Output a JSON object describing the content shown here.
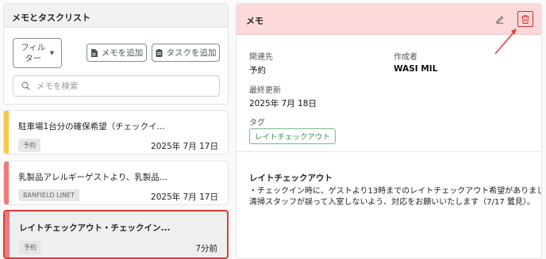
{
  "left_panel": {
    "title": "メモとタスクリスト",
    "filter_label": "フィルター",
    "add_memo_label": "メモを追加",
    "add_task_label": "タスクを追加",
    "search_placeholder": "メモを検索"
  },
  "memo_list": [
    {
      "title": "駐車場1台分の確保希望（チェックイ...",
      "tag": "予約",
      "date": "2025年 7月 17日",
      "color": "#f7c84a"
    },
    {
      "title": "乳製品アレルギーゲストより、乳製品...",
      "tag": "BANFIELD LINET",
      "date": "2025年 7月 17日",
      "color": "#ef7a7a"
    },
    {
      "title": "レイトチェックアウト・チェックイン...",
      "tag": "予約",
      "date": "7分前",
      "color": "#ef7a7a"
    }
  ],
  "detail": {
    "header_title": "メモ",
    "related_label": "関連先",
    "related_value": "予約",
    "author_label": "作成者",
    "author_value": "WASI MIL",
    "updated_label": "最終更新",
    "updated_value": "2025年 7月 18日",
    "tags_label": "タグ",
    "tag_value": "レイトチェックアウト",
    "note_title": "レイトチェックアウト",
    "note_line1": "・チェックイン時に、ゲストより13時までのレイトチェックアウト希望がありました。",
    "note_line2": "清掃スタッフが誤って入室しないよう、対応をお願いいたします（7/17 鷺見）。"
  },
  "colors": {
    "header_bg": "#fcdada",
    "highlight": "#e03a3a",
    "tag_green": "#3a8e57"
  }
}
